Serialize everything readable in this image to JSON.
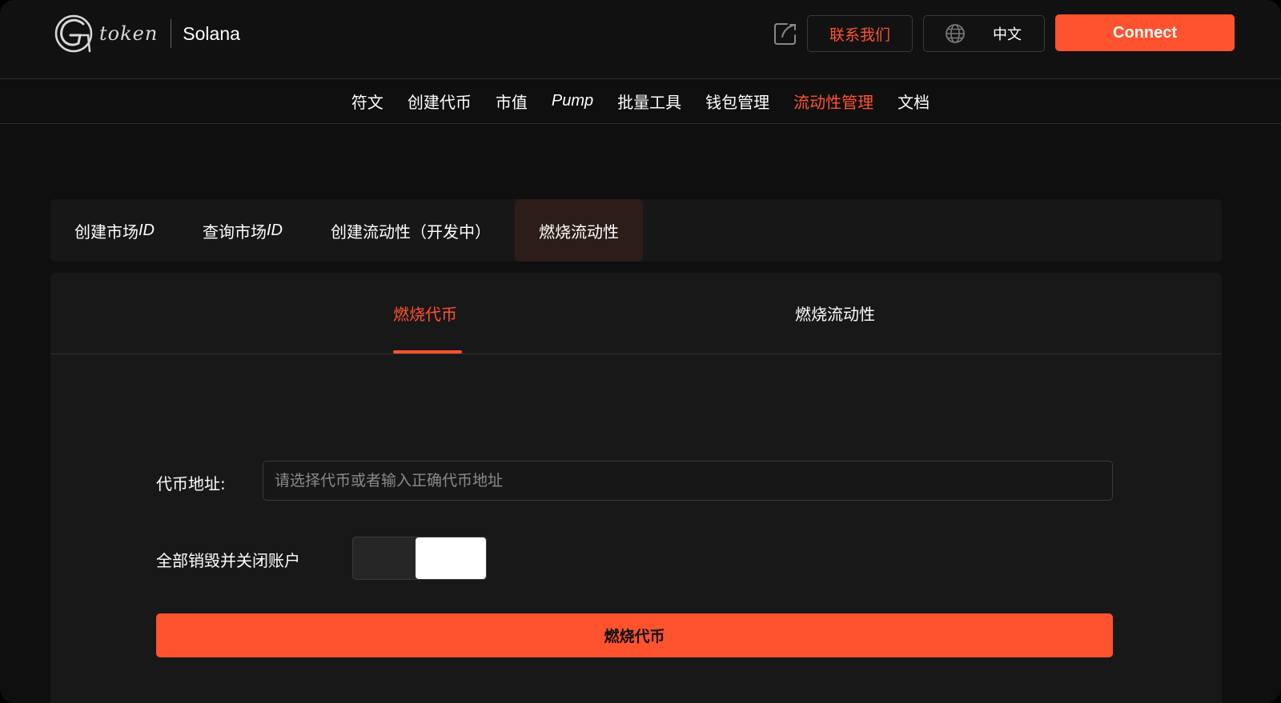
{
  "header": {
    "logo_text": "token",
    "chain": "Solana",
    "contact_label": "联系我们",
    "language_label": "中文",
    "connect_label": "Connect"
  },
  "nav": {
    "items": [
      {
        "label": "符文"
      },
      {
        "label": "创建代币"
      },
      {
        "label": "市值"
      },
      {
        "label": "Pump"
      },
      {
        "label": "批量工具"
      },
      {
        "label": "钱包管理"
      },
      {
        "label": "流动性管理"
      },
      {
        "label": "文档"
      }
    ],
    "active": "流动性管理"
  },
  "tabs": {
    "items": [
      {
        "label": "创建市场",
        "suffix": "ID"
      },
      {
        "label": "查询市场",
        "suffix": "ID"
      },
      {
        "label": "创建流动性（开发中）",
        "suffix": ""
      },
      {
        "label": "燃烧流动性",
        "suffix": ""
      }
    ],
    "active": "燃烧流动性"
  },
  "subtabs": {
    "items": [
      {
        "label": "燃烧代币"
      },
      {
        "label": "燃烧流动性"
      }
    ],
    "active": "燃烧代币"
  },
  "form": {
    "token_address_label": "代币地址:",
    "token_address_value": "",
    "token_address_placeholder": "请选择代币或者输入正确代币地址",
    "close_account_label": "全部销毁并关闭账户",
    "close_account_on": false,
    "submit_label": "燃烧代币"
  },
  "colors": {
    "accent": "#ff522e",
    "background": "#0f0f0f",
    "panel": "#181818"
  }
}
